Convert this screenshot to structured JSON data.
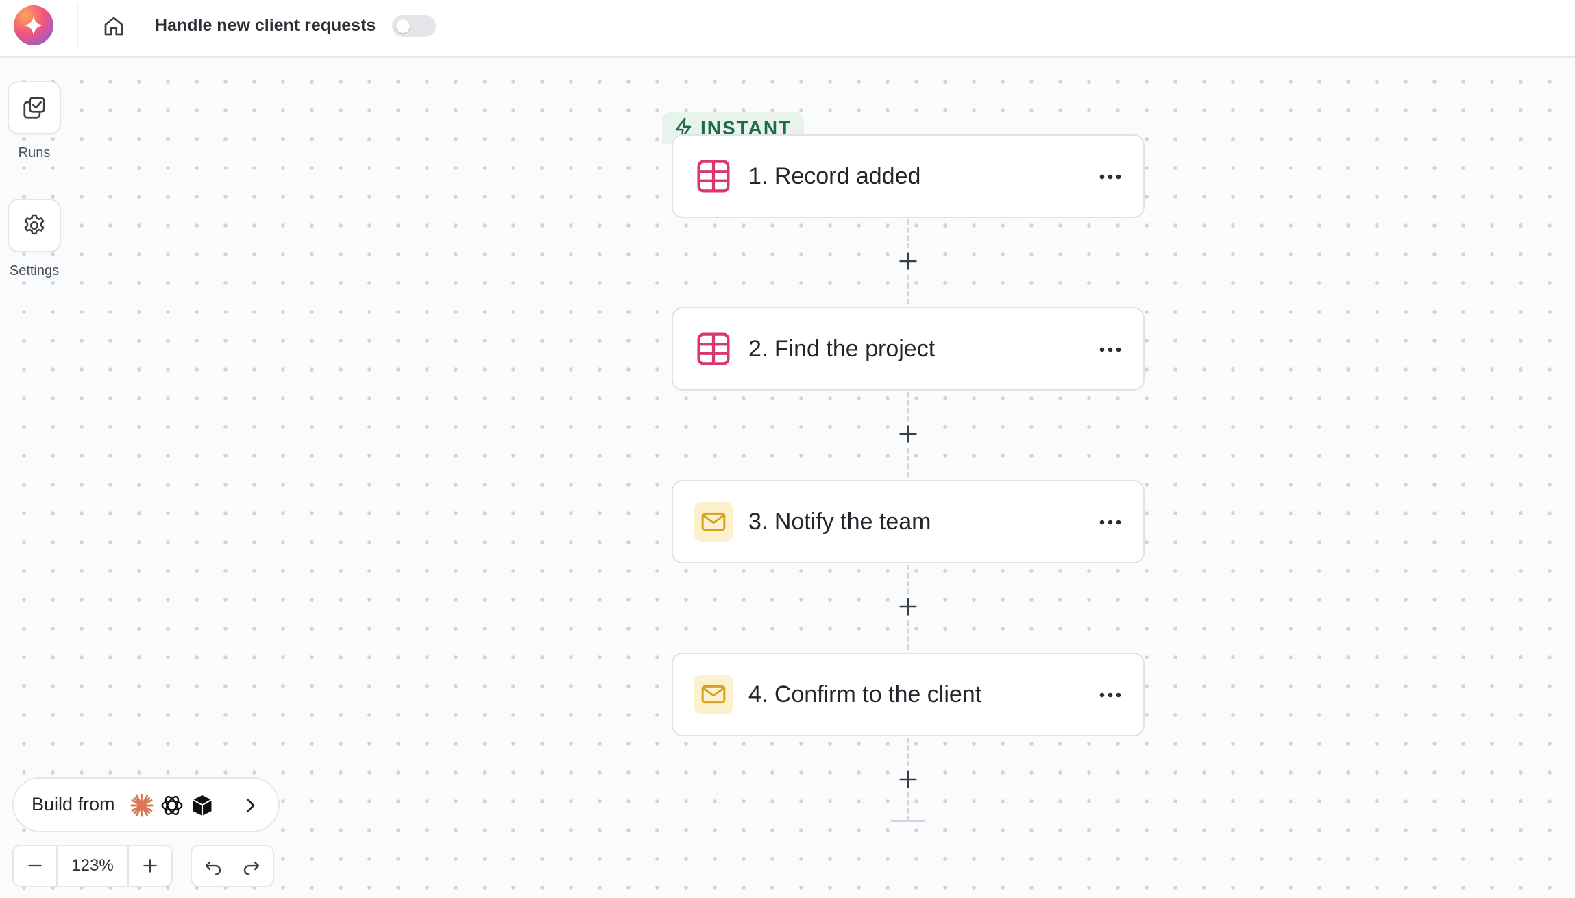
{
  "header": {
    "workflow_title": "Handle new client requests",
    "toggle_state": "off"
  },
  "sidebar": {
    "items": [
      {
        "label": "Runs",
        "icon": "runs-icon"
      },
      {
        "label": "Settings",
        "icon": "gear-icon"
      }
    ]
  },
  "trigger": {
    "tag_label": "INSTANT",
    "icon": "lightning-icon"
  },
  "steps": [
    {
      "number": "1.",
      "title": "Record added",
      "icon": "table-icon"
    },
    {
      "number": "2.",
      "title": "Find the project",
      "icon": "table-icon"
    },
    {
      "number": "3.",
      "title": "Notify the team",
      "icon": "mail-icon"
    },
    {
      "number": "4.",
      "title": "Confirm to the client",
      "icon": "mail-icon"
    }
  ],
  "build_from": {
    "label": "Build from",
    "providers": [
      "claude-icon",
      "openai-icon",
      "cube-icon"
    ]
  },
  "zoom": {
    "level": "123%"
  },
  "colors": {
    "accent_table": "#d9376e",
    "accent_mail": "#d4a21d",
    "instant_bg": "#e7f3ec",
    "instant_text": "#1e6b45"
  }
}
